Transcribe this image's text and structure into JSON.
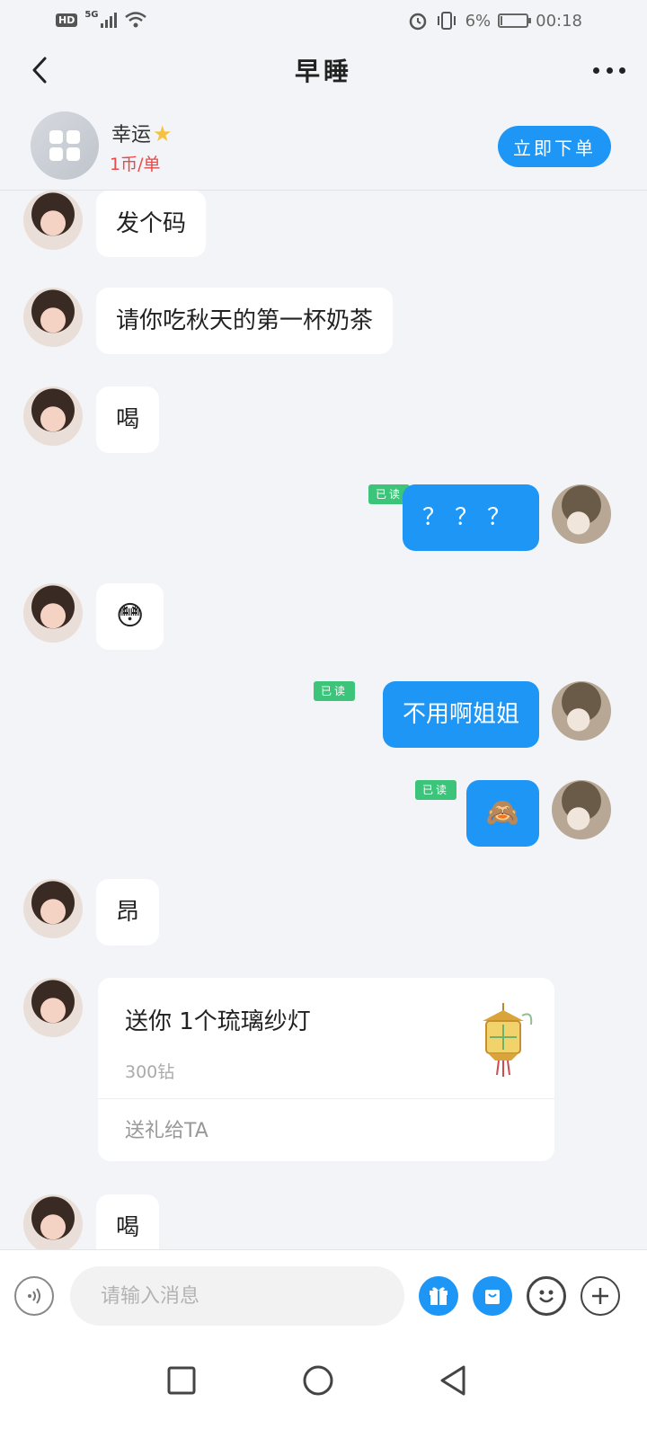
{
  "status_bar": {
    "hd": "HD",
    "network": "5G",
    "battery_percent": "6%",
    "time": "00:18"
  },
  "header": {
    "title": "早睡"
  },
  "profile": {
    "name": "幸运",
    "price": "1币/单",
    "order_button": "立即下单"
  },
  "messages": {
    "m1": "发个码",
    "m2": "请你吃秋天的第一杯奶茶",
    "m3": "喝",
    "m4": "？？？",
    "m5": "😳",
    "m6": "不用啊姐姐",
    "m7": "🙈",
    "m8": "昂",
    "m9": "喝"
  },
  "read_label": "已读",
  "gift": {
    "title": "送你 1个琉璃纱灯",
    "price": "300钻",
    "send_label": "送礼给TA"
  },
  "input": {
    "placeholder": "请输入消息"
  },
  "colors": {
    "accent": "#1e96f6",
    "read_badge": "#3cc57a",
    "price_red": "#e64a4a"
  }
}
